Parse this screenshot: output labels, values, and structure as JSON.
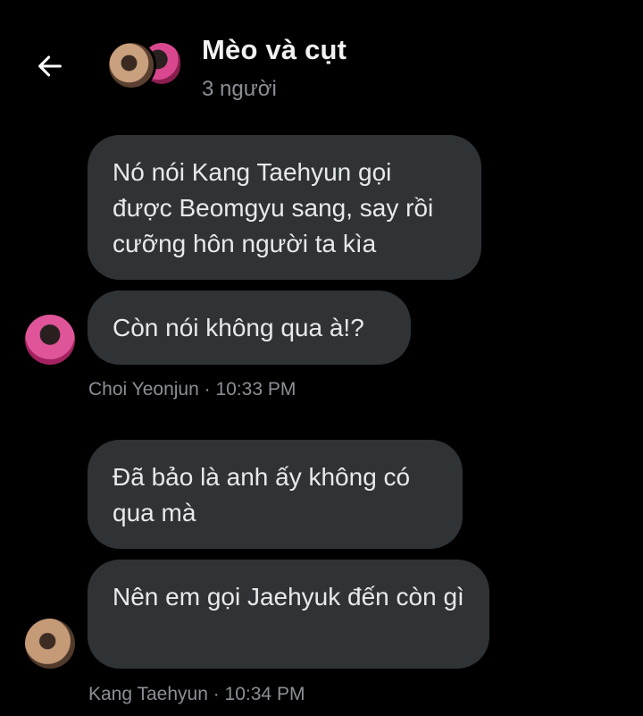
{
  "header": {
    "title": "Mèo và cụt",
    "subtitle": "3 người",
    "back_icon": "arrow-left-icon"
  },
  "messages": [
    {
      "text": "Nó nói Kang Taehyun gọi được Beomgyu sang, say rồi cưỡng hôn người ta kìa"
    },
    {
      "text": "Còn nói không qua à!?"
    },
    {
      "text": "Đã bảo là anh ấy không có qua mà"
    },
    {
      "text": "Nên em gọi Jaehyuk đến còn gì"
    }
  ],
  "groups": [
    {
      "meta": "Choi Yeonjun · 10:33 PM"
    },
    {
      "meta": "Kang Taehyun · 10:34 PM"
    }
  ]
}
